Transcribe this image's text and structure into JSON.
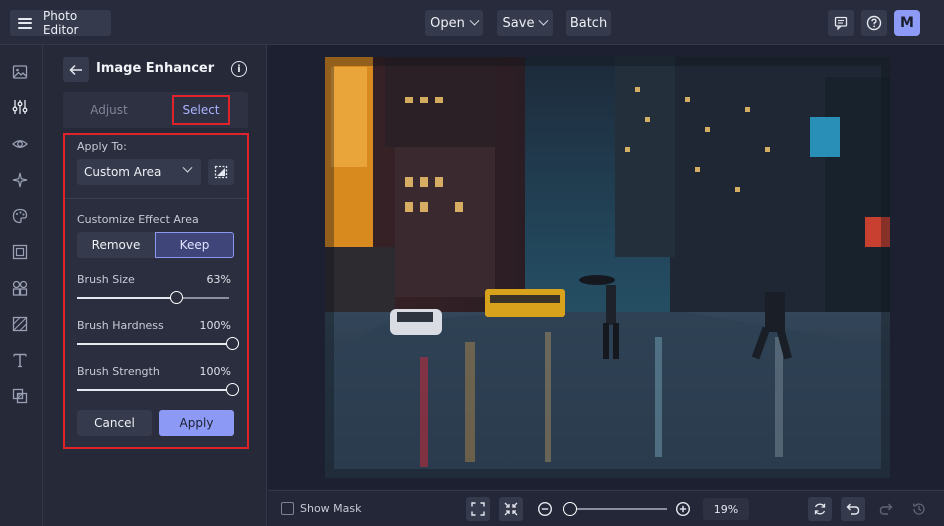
{
  "header": {
    "app_title": "Photo Editor",
    "menu": {
      "open_label": "Open",
      "save_label": "Save",
      "batch_label": "Batch"
    },
    "avatar_initial": "M",
    "icons": [
      "menu-icon",
      "comment-icon",
      "help-icon"
    ]
  },
  "rail": {
    "icons": [
      "image-icon",
      "adjustments-icon",
      "eye-icon",
      "effects-icon",
      "palette-icon",
      "frame-icon",
      "shapes-icon",
      "texture-icon",
      "text-icon",
      "overlay-icon"
    ],
    "active_index": 1
  },
  "panel": {
    "title": "Image Enhancer",
    "tabs": {
      "adjust": "Adjust",
      "select": "Select",
      "active": "Select"
    },
    "apply_to_label": "Apply To:",
    "apply_to_value": "Custom Area",
    "customize_label": "Customize Effect Area",
    "remove_label": "Remove",
    "keep_label": "Keep",
    "sliders": [
      {
        "label": "Brush Size",
        "value": "63%",
        "fraction": 0.63
      },
      {
        "label": "Brush Hardness",
        "value": "100%",
        "fraction": 1.0
      },
      {
        "label": "Brush Strength",
        "value": "100%",
        "fraction": 1.0
      }
    ],
    "cancel_label": "Cancel",
    "apply_label": "Apply"
  },
  "footer": {
    "show_mask_label": "Show Mask",
    "zoom_value": "19%",
    "zoom_fraction": 0.0
  },
  "colors": {
    "accent": "#8d9af5",
    "highlight": "#e0222a",
    "background": "#1f2333"
  }
}
